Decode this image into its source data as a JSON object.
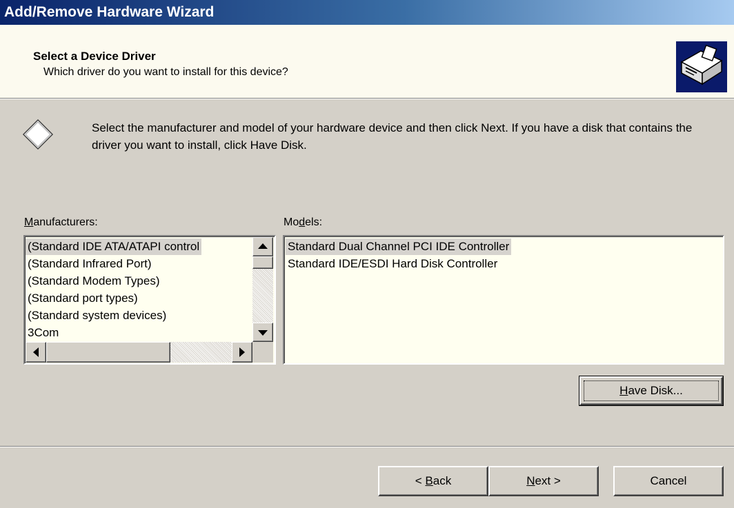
{
  "window": {
    "title": "Add/Remove Hardware Wizard"
  },
  "header": {
    "title": "Select a Device Driver",
    "subtitle": "Which driver do you want to install for this device?",
    "icon": "hardware-wizard-icon"
  },
  "intro": {
    "icon": "diamond-icon",
    "text": "Select the manufacturer and model of your hardware device and then click Next. If you have a disk that contains the driver you want to install, click Have Disk."
  },
  "manufacturers": {
    "label_prefix": "M",
    "label_rest": "anufacturers:",
    "items": [
      "(Standard IDE ATA/ATAPI control",
      "(Standard Infrared Port)",
      "(Standard Modem Types)",
      "(Standard port types)",
      "(Standard system devices)",
      "3Com"
    ],
    "selected_index": 0
  },
  "models": {
    "label_prefix": "Mo",
    "label_underline": "d",
    "label_rest": "els:",
    "items": [
      "Standard Dual Channel PCI IDE Controller",
      "Standard IDE/ESDI Hard Disk Controller"
    ],
    "selected_index": 0
  },
  "buttons": {
    "have_disk_u": "H",
    "have_disk_rest": "ave Disk...",
    "back_prefix": "< ",
    "back_u": "B",
    "back_rest": "ack",
    "next_u": "N",
    "next_rest": "ext >",
    "cancel": "Cancel"
  },
  "colors": {
    "titlebar_start": "#0a246a",
    "titlebar_end": "#a6caf0",
    "dialog_bg": "#d4d0c8",
    "header_bg": "#fcfaef",
    "list_bg": "#fffff0"
  }
}
